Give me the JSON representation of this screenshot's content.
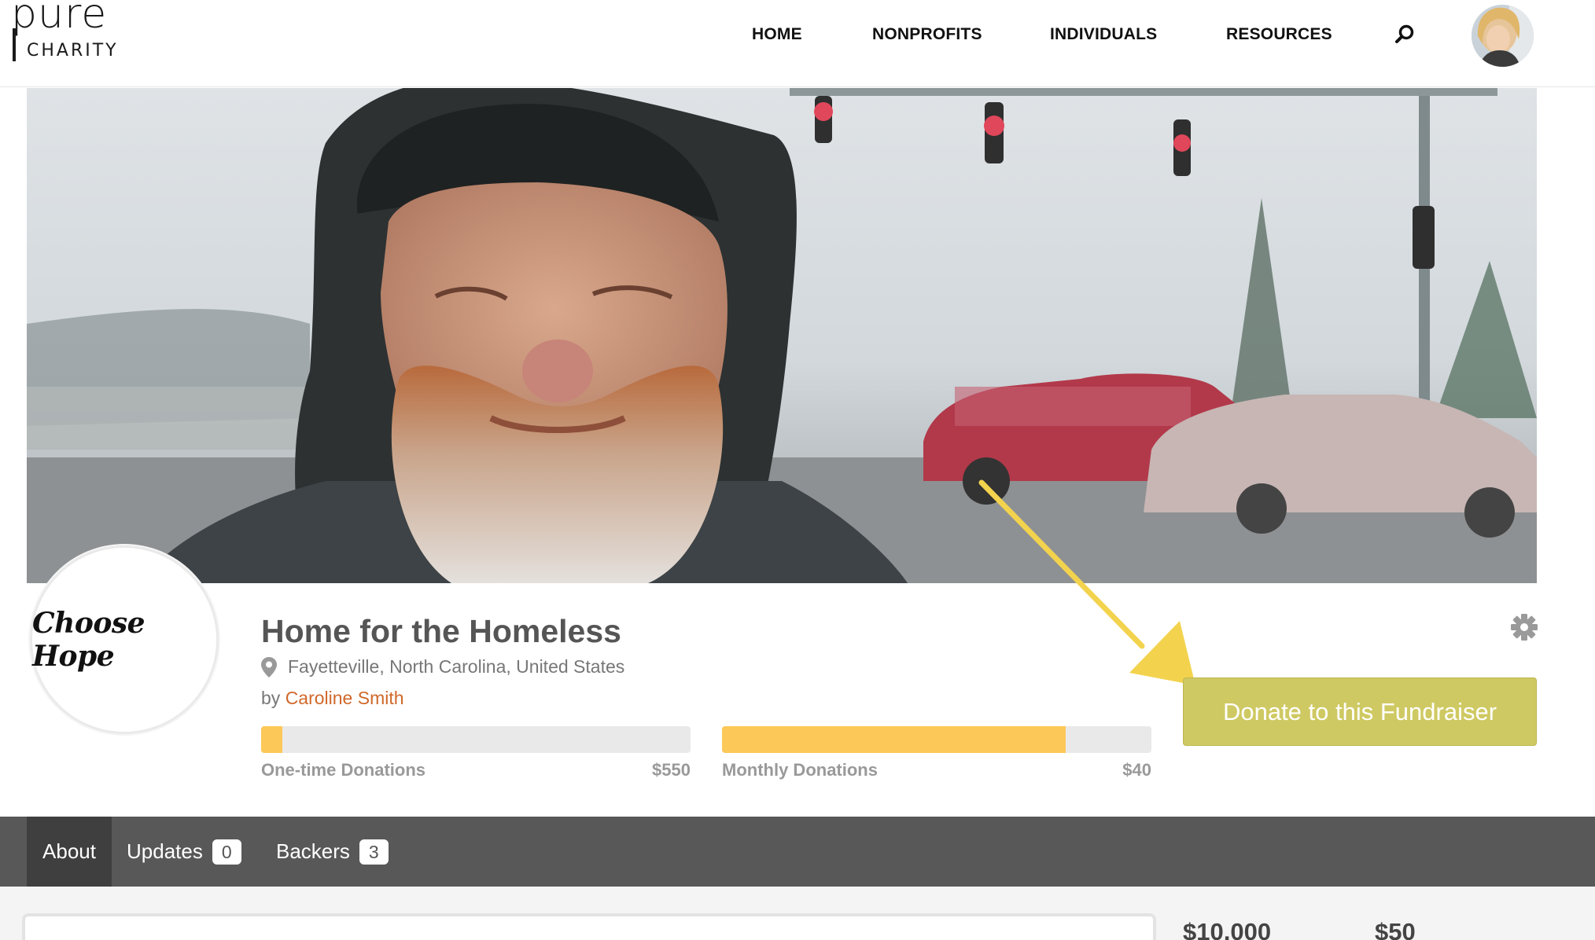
{
  "brand": {
    "name_top": "pure",
    "name_bottom": "CHARITY"
  },
  "nav": {
    "items": [
      {
        "label": "HOME"
      },
      {
        "label": "NONPROFITS"
      },
      {
        "label": "INDIVIDUALS"
      },
      {
        "label": "RESOURCES"
      }
    ],
    "search_icon": "search-icon",
    "avatar": "user-avatar"
  },
  "fundraiser": {
    "logo_text": "Choose Hope",
    "title": "Home for the Homeless",
    "location": "Fayetteville, North Carolina, United States",
    "by_prefix": "by",
    "author": "Caroline Smith",
    "one_time": {
      "label": "One-time Donations",
      "amount": "$550",
      "progress": 0.05
    },
    "monthly": {
      "label": "Monthly Donations",
      "amount": "$40",
      "progress": 0.8
    },
    "donate_label": "Donate to this Fundraiser",
    "settings_icon": "gear-icon"
  },
  "tabs": [
    {
      "label": "About",
      "count": ""
    },
    {
      "label": "Updates",
      "count": "0"
    },
    {
      "label": "Backers",
      "count": "3"
    }
  ],
  "stats": {
    "goal": "$10,000",
    "other": "$50"
  },
  "colors": {
    "accent": "#d0682a",
    "donate_button": "#cfc963",
    "progress_fill": "#fcc858",
    "tab_bar": "#585858",
    "annotation_arrow": "#f3d34e"
  }
}
